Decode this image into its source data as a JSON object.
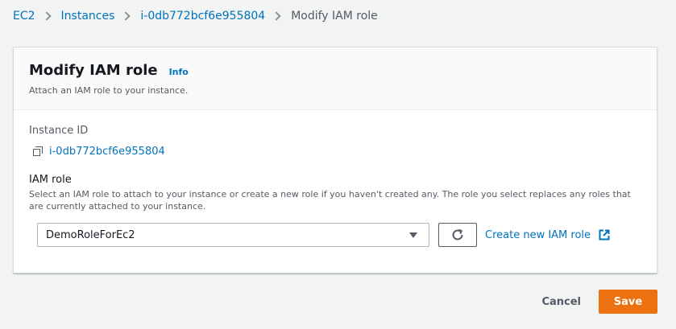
{
  "breadcrumb": {
    "items": [
      {
        "label": "EC2"
      },
      {
        "label": "Instances"
      },
      {
        "label": "i-0db772bcf6e955804"
      }
    ],
    "current": "Modify IAM role"
  },
  "card": {
    "title": "Modify IAM role",
    "info_label": "Info",
    "description": "Attach an IAM role to your instance."
  },
  "instance": {
    "label": "Instance ID",
    "value": "i-0db772bcf6e955804"
  },
  "iam_role": {
    "label": "IAM role",
    "description": "Select an IAM role to attach to your instance or create a new role if you haven't created any. The role you select replaces any roles that are currently attached to your instance.",
    "selected": "DemoRoleForEc2",
    "create_label": "Create new IAM role"
  },
  "actions": {
    "cancel_label": "Cancel",
    "save_label": "Save"
  },
  "colors": {
    "link": "#0073bb",
    "primary_button": "#ec7211",
    "background": "#f2f3f3"
  }
}
